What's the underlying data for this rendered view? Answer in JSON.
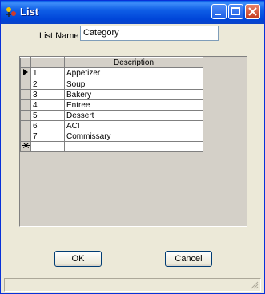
{
  "window": {
    "title": "List"
  },
  "form": {
    "list_name_label": "List Name",
    "list_name_value": "Category"
  },
  "grid": {
    "columns": [
      "",
      "Description"
    ],
    "rows": [
      {
        "id": "1",
        "description": "Appetizer"
      },
      {
        "id": "2",
        "description": "Soup"
      },
      {
        "id": "3",
        "description": "Bakery"
      },
      {
        "id": "4",
        "description": "Entree"
      },
      {
        "id": "5",
        "description": "Dessert"
      },
      {
        "id": "6",
        "description": "ACI"
      },
      {
        "id": "7",
        "description": "Commissary"
      }
    ],
    "current_row_indicator": "arrow-right-icon",
    "new_row_indicator": "asterisk-icon"
  },
  "buttons": {
    "ok_label": "OK",
    "cancel_label": "Cancel"
  },
  "colors": {
    "titlebar": "#0a5fe8",
    "window_bg": "#ece9d8",
    "grid_bg": "#d4d0c8"
  }
}
